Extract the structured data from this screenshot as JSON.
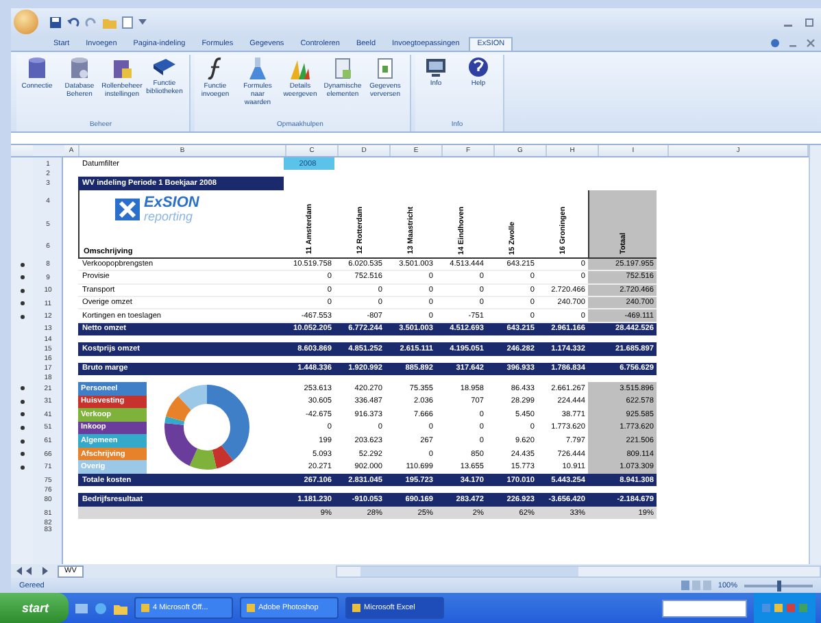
{
  "ribbon": {
    "tabs": [
      {
        "label": "Start",
        "selected": false
      },
      {
        "label": "Invoegen",
        "selected": false
      },
      {
        "label": "Pagina-indeling",
        "selected": false
      },
      {
        "label": "Formules",
        "selected": false
      },
      {
        "label": "Gegevens",
        "selected": false
      },
      {
        "label": "Controleren",
        "selected": false
      },
      {
        "label": "Beeld",
        "selected": false
      },
      {
        "label": "Invoegtoepassingen",
        "selected": false
      },
      {
        "label": "ExSION",
        "selected": true
      }
    ],
    "groups": [
      {
        "label": "Beheer",
        "buttons": [
          {
            "label": "Connectie"
          },
          {
            "label": "Database Beheren"
          },
          {
            "label": "Rollenbeheer instellingen"
          },
          {
            "label": "Functie bibliotheken"
          }
        ]
      },
      {
        "label": "Opmaakhulpen",
        "buttons": [
          {
            "label": "Functie invoegen"
          },
          {
            "label": "Formules naar waarden"
          },
          {
            "label": "Details weergeven"
          },
          {
            "label": "Dynamische elementen"
          },
          {
            "label": "Gegevens verversen"
          }
        ]
      },
      {
        "label": "Info",
        "buttons": [
          {
            "label": "Info"
          },
          {
            "label": "Help"
          }
        ]
      }
    ]
  },
  "sheet": {
    "columns": [
      "A",
      "B",
      "C",
      "D",
      "E",
      "F",
      "G",
      "H",
      "I",
      "J"
    ],
    "rows": [
      {
        "number": "1",
        "kind": "filter",
        "label": "Datumfilter",
        "value": "2008"
      },
      {
        "number": "2",
        "kind": "blank"
      },
      {
        "number": "3",
        "kind": "title",
        "label": "WV indeling Periode 1 Boekjaar 2008"
      },
      {
        "numbers": [
          "4",
          "5",
          "6"
        ],
        "kind": "header",
        "logo": "ExSION",
        "logo_sub": "reporting",
        "label": "Omschrijving",
        "columns": [
          "11 Amsterdam",
          "12 Rotterdam",
          "13 Maastricht",
          "14 Eindhoven",
          "15 Zwolle",
          "16 Groningen",
          "Totaal"
        ]
      },
      {
        "number": "8",
        "kind": "data",
        "label": "Verkoopopbrengsten",
        "values": [
          "10.519.758",
          "6.020.535",
          "3.501.003",
          "4.513.444",
          "643.215",
          "0",
          "25.197.955"
        ]
      },
      {
        "number": "9",
        "kind": "data",
        "label": "Provisie",
        "values": [
          "0",
          "752.516",
          "0",
          "0",
          "0",
          "0",
          "752.516"
        ]
      },
      {
        "number": "10",
        "kind": "data",
        "label": "Transport",
        "values": [
          "0",
          "0",
          "0",
          "0",
          "0",
          "2.720.466",
          "2.720.466"
        ]
      },
      {
        "number": "11",
        "kind": "data",
        "label": "Overige omzet",
        "values": [
          "0",
          "0",
          "0",
          "0",
          "0",
          "240.700",
          "240.700"
        ]
      },
      {
        "number": "12",
        "kind": "data",
        "label": "Kortingen en toeslagen",
        "values": [
          "-467.553",
          "-807",
          "0",
          "-751",
          "0",
          "0",
          "-469.111"
        ]
      },
      {
        "number": "13",
        "kind": "band",
        "label": "Netto omzet",
        "values": [
          "10.052.205",
          "6.772.244",
          "3.501.003",
          "4.512.693",
          "643.215",
          "2.961.166",
          "28.442.526"
        ]
      },
      {
        "number": "14",
        "kind": "blank"
      },
      {
        "number": "15",
        "kind": "band",
        "label": "Kostprijs omzet",
        "values": [
          "8.603.869",
          "4.851.252",
          "2.615.111",
          "4.195.051",
          "246.282",
          "1.174.332",
          "21.685.897"
        ]
      },
      {
        "number": "16",
        "kind": "blank"
      },
      {
        "number": "17",
        "kind": "band",
        "label": "Bruto marge",
        "values": [
          "1.448.336",
          "1.920.992",
          "885.892",
          "317.642",
          "396.933",
          "1.786.834",
          "6.756.629"
        ]
      },
      {
        "number": "18",
        "kind": "blank"
      },
      {
        "number": "21",
        "kind": "cost",
        "label": "Personeel",
        "color": "#3f7fc8",
        "values": [
          "253.613",
          "420.270",
          "75.355",
          "18.958",
          "86.433",
          "2.661.267",
          "3.515.896"
        ]
      },
      {
        "number": "31",
        "kind": "cost",
        "label": "Huisvesting",
        "color": "#c8322d",
        "values": [
          "30.605",
          "336.487",
          "2.036",
          "707",
          "28.299",
          "224.444",
          "622.578"
        ]
      },
      {
        "number": "41",
        "kind": "cost",
        "label": "Verkoop",
        "color": "#7fb23a",
        "values": [
          "-42.675",
          "916.373",
          "7.666",
          "0",
          "5.450",
          "38.771",
          "925.585"
        ]
      },
      {
        "number": "51",
        "kind": "cost",
        "label": "Inkoop",
        "color": "#6a3c9c",
        "values": [
          "0",
          "0",
          "0",
          "0",
          "0",
          "1.773.620",
          "1.773.620"
        ]
      },
      {
        "number": "61",
        "kind": "cost",
        "label": "Algemeen",
        "color": "#35a9c9",
        "values": [
          "199",
          "203.623",
          "267",
          "0",
          "9.620",
          "7.797",
          "221.506"
        ]
      },
      {
        "number": "66",
        "kind": "cost",
        "label": "Afschrijving",
        "color": "#e8822a",
        "values": [
          "5.093",
          "52.292",
          "0",
          "850",
          "24.435",
          "726.444",
          "809.114"
        ]
      },
      {
        "number": "71",
        "kind": "cost",
        "label": "Overig",
        "color": "#9cc8e8",
        "values": [
          "20.271",
          "902.000",
          "110.699",
          "13.655",
          "15.773",
          "10.911",
          "1.073.309"
        ]
      },
      {
        "number": "75",
        "kind": "band",
        "label": "Totale kosten",
        "values": [
          "267.106",
          "2.831.045",
          "195.723",
          "34.170",
          "170.010",
          "5.443.254",
          "8.941.308"
        ]
      },
      {
        "number": "76",
        "kind": "blank"
      },
      {
        "number": "80",
        "kind": "band",
        "label": "Bedrijfsresultaat",
        "values": [
          "1.181.230",
          "-910.053",
          "690.169",
          "283.472",
          "226.923",
          "-3.656.420",
          "-2.184.679"
        ]
      },
      {
        "number": "81",
        "kind": "pct",
        "values": [
          "9%",
          "28%",
          "25%",
          "2%",
          "62%",
          "33%",
          "19%"
        ]
      },
      {
        "number": "82",
        "kind": "blank"
      },
      {
        "number": "83",
        "kind": "blank"
      }
    ]
  },
  "sheet_tabs": [
    {
      "label": "WV",
      "selected": true
    }
  ],
  "status_bar": {
    "text": "Gereed",
    "zoom": "100%",
    "zoom_slider": {
      "level": 0.5
    }
  },
  "taskbar": {
    "start": "start",
    "tasks": [
      {
        "label": "4 Microsoft Off...",
        "selected": false
      },
      {
        "label": "Adobe Photoshop",
        "selected": false
      },
      {
        "label": "Microsoft Excel",
        "selected": true
      }
    ]
  }
}
